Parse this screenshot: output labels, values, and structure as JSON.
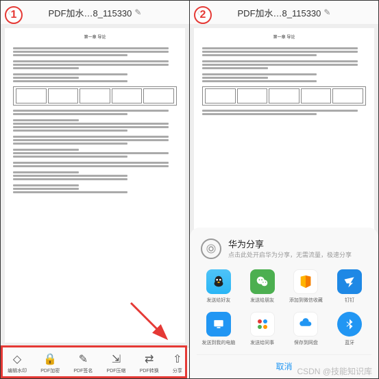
{
  "header": {
    "title": "PDF加水…8_115330",
    "back": "‹"
  },
  "markers": {
    "left": "1",
    "right": "2"
  },
  "doc": {
    "title": "第一章 导论"
  },
  "toolbar": [
    {
      "icon": "◇",
      "label": "编辑水印",
      "name": "watermark-tool"
    },
    {
      "icon": "🔒",
      "label": "PDF加密",
      "name": "encrypt-tool"
    },
    {
      "icon": "✎",
      "label": "PDF签名",
      "name": "sign-tool"
    },
    {
      "icon": "⇲",
      "label": "PDF压缩",
      "name": "compress-tool"
    },
    {
      "icon": "⇄",
      "label": "PDF转换",
      "name": "convert-tool"
    },
    {
      "icon": "⇧",
      "label": "分享",
      "name": "share-tool"
    }
  ],
  "huawei_share": {
    "title": "华为分享",
    "subtitle": "点击此处开启华为分享，无需流量，极速分享"
  },
  "share_row1": [
    {
      "label": "发送给好友",
      "cls": "qq",
      "name": "share-qq"
    },
    {
      "label": "发送给朋友",
      "cls": "wechat",
      "name": "share-wechat"
    },
    {
      "label": "添加到微信收藏",
      "cls": "contact",
      "name": "share-wx-fav"
    },
    {
      "label": "钉钉",
      "cls": "dingtalk",
      "name": "share-dingtalk"
    }
  ],
  "share_row2": [
    {
      "label": "发送到我的电脑",
      "cls": "pc",
      "name": "share-pc"
    },
    {
      "label": "发送给同事",
      "cls": "tongshi",
      "name": "share-colleague"
    },
    {
      "label": "保存到网盘",
      "cls": "cloud",
      "name": "share-cloud"
    },
    {
      "label": "蓝牙",
      "cls": "bt",
      "name": "share-bluetooth"
    }
  ],
  "cancel": "取消",
  "watermark": "CSDN @技能知识库"
}
